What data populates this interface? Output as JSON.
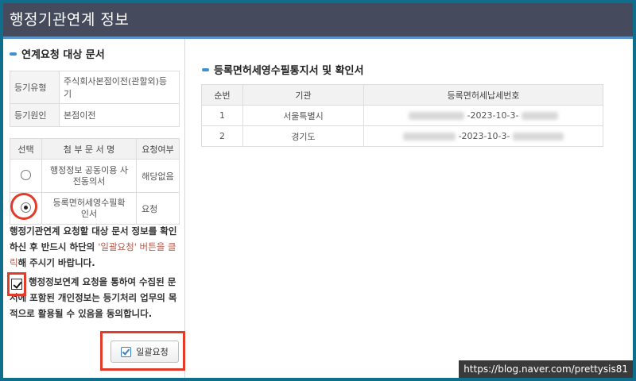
{
  "window": {
    "title": "행정기관연계 정보"
  },
  "left": {
    "section_title": "연계요청 대상 문서",
    "info_rows": [
      {
        "label": "등기유형",
        "value": "주식회사본점이전(관할외)등기"
      },
      {
        "label": "등기원인",
        "value": "본점이전"
      }
    ],
    "doc_table": {
      "headers": [
        "선택",
        "첨 부 문 서 명",
        "요청여부"
      ],
      "rows": [
        {
          "selected": false,
          "name": "행정정보 공동이용 사전동의서",
          "status": "해당없음"
        },
        {
          "selected": true,
          "name": "등록면허세영수필확인서",
          "status": "요청"
        }
      ]
    },
    "notice": {
      "prefix": "행정기관연계 요청할 대상 문서 정보를 확인하신 후 반드시 하단의 ",
      "accent": "'일괄요청' 버튼을 클릭",
      "suffix": "해 주시기 바랍니다."
    },
    "agreement": {
      "checked": true,
      "text": "행정정보연계 요청을 통하여 수집된 문서에 포함된 개인정보는 등기처리 업무의 목적으로 활용될 수 있음을 동의합니다."
    },
    "batch_button": {
      "label": "일괄요청"
    }
  },
  "right": {
    "section_title": "등록면허세영수필통지서 및 확인서",
    "table": {
      "headers": [
        "순번",
        "기관",
        "등록면허세납세번호"
      ],
      "rows": [
        {
          "no": "1",
          "agency": "서울특별시",
          "tax_no_visible": "-2023-10-3-"
        },
        {
          "no": "2",
          "agency": "경기도",
          "tax_no_visible": "-2023-10-3-"
        }
      ]
    }
  },
  "watermark": "https://blog.naver.com/prettysis81",
  "colors": {
    "background": "#0f6e8c",
    "titlebar": "#454b5c",
    "accent_bar": "#3f8fd4",
    "highlight": "#e23b2a"
  }
}
